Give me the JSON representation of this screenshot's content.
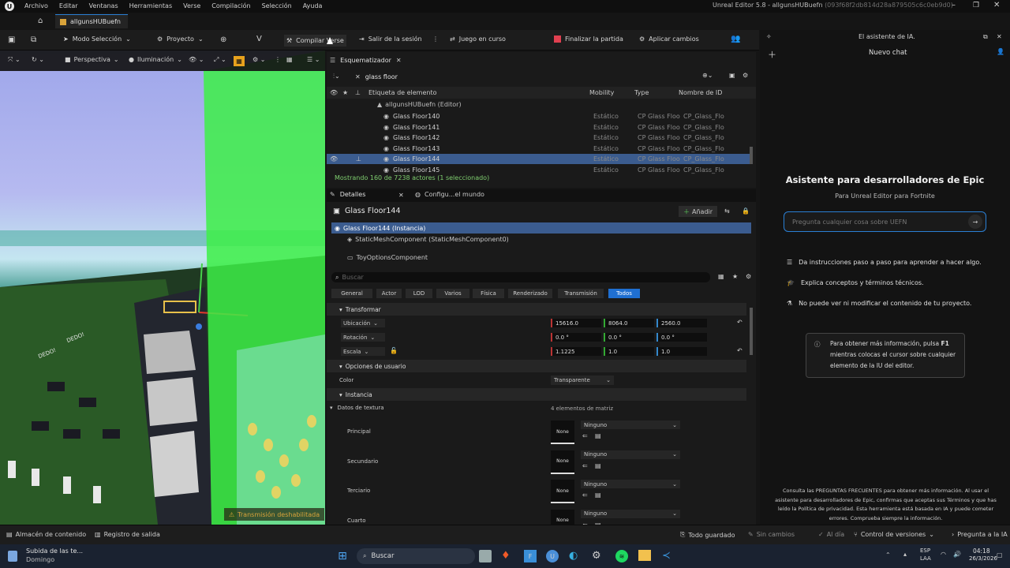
{
  "menu": {
    "items": [
      "Archivo",
      "Editar",
      "Ventanas",
      "Herramientas",
      "Verse",
      "Compilación",
      "Selección",
      "Ayuda"
    ],
    "window_title": "Unreal Editor 5.8 - allgunsHUBuefn",
    "window_id": "(093f68f2db814d28a879505c6c0eb9d0)"
  },
  "tab": {
    "label": "allgunsHUBuefn"
  },
  "toolbar": {
    "mode": "Modo Selección",
    "project": "Proyecto",
    "compile": "Compilar Verse",
    "exit": "Salir de la sesión",
    "game": "Juego en curso",
    "end": "Finalizar la partida",
    "apply": "Aplicar cambios"
  },
  "viewport": {
    "perspective": "Perspectiva",
    "lighting": "Iluminación",
    "warning": "Transmisión deshabilitada",
    "sign1": "DEDO!",
    "sign2": "DEDO!"
  },
  "outliner": {
    "title": "Esquematizador",
    "search": "glass floor",
    "col_label": "Etiqueta de elemento",
    "col_mobility": "Mobility",
    "col_type": "Type",
    "col_id": "Nombre de ID",
    "root": "allgunsHUBuefn (Editor)",
    "rows": [
      {
        "name": "Glass Floor140",
        "mobility": "Estático",
        "type": "CP Glass Floo",
        "id": "CP_Glass_Flo"
      },
      {
        "name": "Glass Floor141",
        "mobility": "Estático",
        "type": "CP Glass Floo",
        "id": "CP_Glass_Flo"
      },
      {
        "name": "Glass Floor142",
        "mobility": "Estático",
        "type": "CP Glass Floo",
        "id": "CP_Glass_Flo"
      },
      {
        "name": "Glass Floor143",
        "mobility": "Estático",
        "type": "CP Glass Floo",
        "id": "CP_Glass_Flo"
      },
      {
        "name": "Glass Floor144",
        "mobility": "Estático",
        "type": "CP Glass Floo",
        "id": "CP_Glass_Flo"
      },
      {
        "name": "Glass Floor145",
        "mobility": "Estático",
        "type": "CP Glass Floo",
        "id": "CP_Glass_Flo"
      }
    ],
    "selected_index": 4,
    "status": "Mostrando 160 de 7238 actores (1 seleccionado)"
  },
  "details": {
    "tab1": "Detalles",
    "tab2": "Configu...el mundo",
    "object_name": "Glass Floor144",
    "add_label": "Añadir",
    "instance": "Glass Floor144 (Instancia)",
    "component1": "StaticMeshComponent (StaticMeshComponent0)",
    "component2": "ToyOptionsComponent",
    "search_placeholder": "Buscar",
    "filters": [
      "General",
      "Actor",
      "LOD",
      "Varios",
      "Física",
      "Renderizado",
      "Transmisión",
      "Todos"
    ],
    "active_filter": "Todos",
    "transform_label": "Transformar",
    "location_label": "Ubicación",
    "location": [
      "15616.0",
      "8064.0",
      "2560.0"
    ],
    "rotation_label": "Rotación",
    "rotation": [
      "0.0 °",
      "0.0 °",
      "0.0 °"
    ],
    "scale_label": "Escala",
    "scale": [
      "1.1225",
      "1.0",
      "1.0"
    ],
    "user_options": "Opciones de usuario",
    "color_label": "Color",
    "color_value": "Transparente",
    "instance_section": "Instancia",
    "texture_label": "Datos de textura",
    "texture_count": "4 elementos de matriz",
    "textures": [
      {
        "label": "Principal",
        "value": "Ninguno",
        "thumb": "None"
      },
      {
        "label": "Secundario",
        "value": "Ninguno",
        "thumb": "None"
      },
      {
        "label": "Terciario",
        "value": "Ninguno",
        "thumb": "None"
      },
      {
        "label": "Cuarto",
        "value": "Ninguno",
        "thumb": "None"
      }
    ]
  },
  "ai": {
    "header": "El asistente de IA.",
    "new_chat": "Nuevo chat",
    "title": "Asistente para desarrolladores de Epic",
    "subtitle": "Para Unreal Editor para Fortnite",
    "input_placeholder": "Pregunta cualquier cosa sobre UEFN",
    "features": [
      "Da instrucciones paso a paso para aprender a hacer algo.",
      "Explica conceptos y términos técnicos.",
      "No puede ver ni modificar el contenido de tu proyecto."
    ],
    "tip_pre": "Para obtener más información, pulsa ",
    "tip_key": "F1",
    "tip_post": " mientras colocas el cursor sobre cualquier elemento de la IU del editor.",
    "footer": "Consulta las PREGUNTAS FRECUENTES para obtener más información. Al usar el asistente para desarrolladores de Epic, confirmas que aceptas sus Términos y que has leído la Política de privacidad. Esta herramienta está basada en IA y puede cometer errores. Comprueba siempre la información."
  },
  "statusbar": {
    "content": "Almacén de contenido",
    "log": "Registro de salida",
    "saved": "Todo guardado",
    "no_changes": "Sin cambios",
    "up_to_date": "Al día",
    "version_control": "Control de versiones",
    "ask_ai": "Pregunta a la IA"
  },
  "taskbar": {
    "weather_title": "Subida de las te...",
    "weather_sub": "Domingo",
    "search": "Buscar",
    "lang1": "ESP",
    "lang2": "LAA",
    "time": "04:18",
    "date": "26/3/2026"
  },
  "colors": {
    "accent": "#2a7fd4",
    "selected": "#3b5c8f",
    "active_filter": "#1f6fd1",
    "green_highlight": "#3df046",
    "warning": "#d9a33a"
  }
}
